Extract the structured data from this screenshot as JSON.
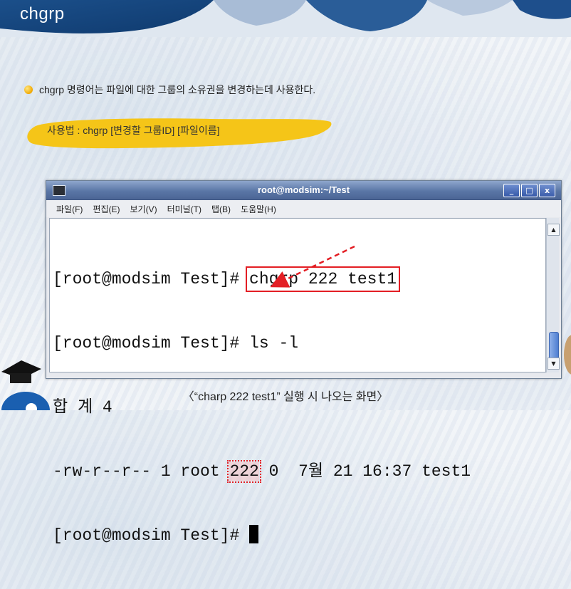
{
  "slide": {
    "title": "chgrp",
    "bullet": "chgrp 명령어는 파일에 대한 그룹의 소유권을 변경하는데 사용한다.",
    "usage": "사용법 : chgrp [변경할 그룹ID] [파일이름]",
    "caption": "〈“charp 222 test1” 실행 시 나오는 화면〉"
  },
  "window": {
    "title": "root@modsim:~/Test",
    "buttons": [
      "_",
      "□",
      "x"
    ],
    "menu": [
      "파일(F)",
      "편집(E)",
      "보기(V)",
      "터미널(T)",
      "탭(B)",
      "도움말(H)"
    ]
  },
  "terminal": {
    "prompt": "[root@modsim Test]# ",
    "cmd1": "chgrp 222 test1",
    "cmd2": "ls -l",
    "total": "합 계 4",
    "ls_perms": "-rw-r--r-- 1 root ",
    "ls_group": "222",
    "ls_rest": " 0  7월 21 16:37 test1"
  },
  "colors": {
    "highlight": "#e31e24",
    "usage_blob": "#f5c518",
    "titlebar": "#5a76a6"
  },
  "icons": [
    "terminal-app-icon",
    "minimize-icon",
    "maximize-icon",
    "close-icon",
    "scroll-up-icon",
    "scroll-down-icon"
  ]
}
